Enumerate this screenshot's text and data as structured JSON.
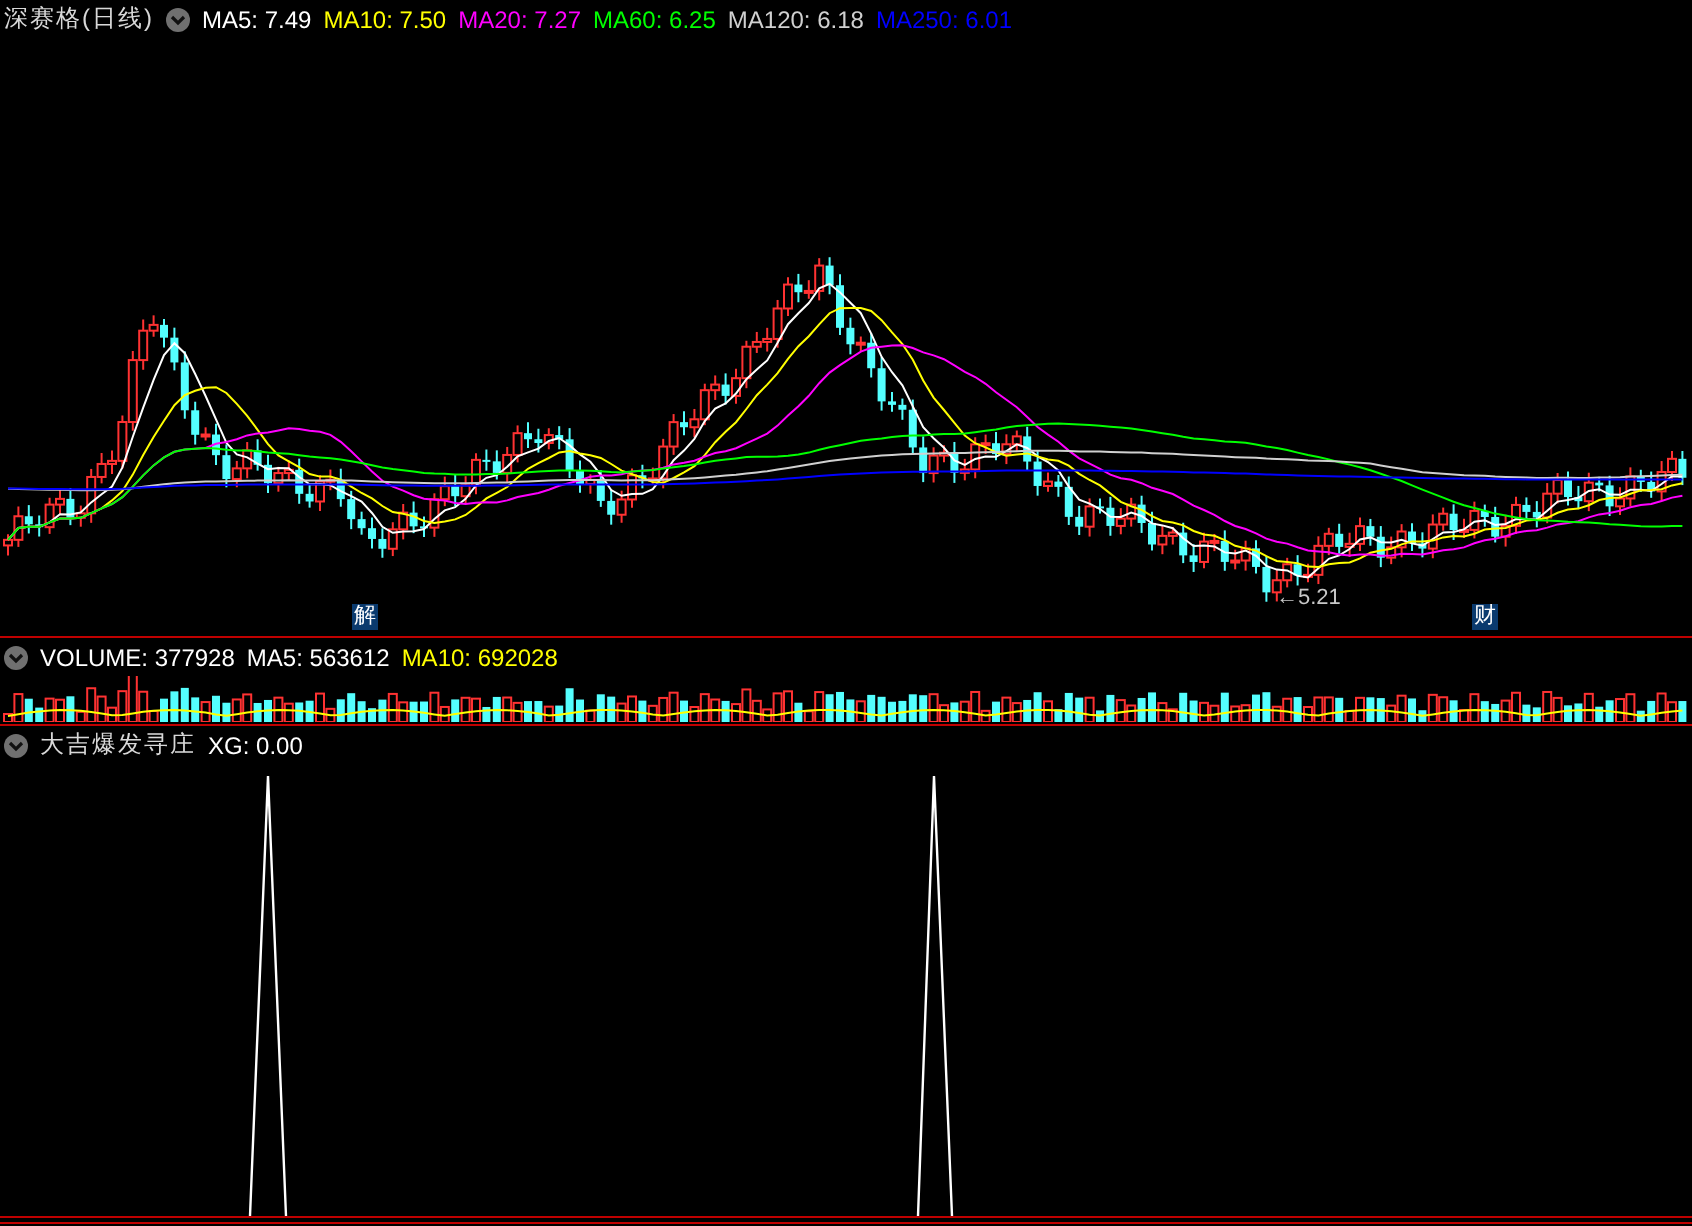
{
  "header": {
    "title": "深赛格(日线)",
    "ma_legend": [
      {
        "label": "MA5:",
        "value": "7.49",
        "color": "#ffffff"
      },
      {
        "label": "MA10:",
        "value": "7.50",
        "color": "#ffff00"
      },
      {
        "label": "MA20:",
        "value": "7.27",
        "color": "#ff00ff"
      },
      {
        "label": "MA60:",
        "value": "6.25",
        "color": "#00ff00"
      },
      {
        "label": "MA120:",
        "value": "6.18",
        "color": "#d0d0d0"
      },
      {
        "label": "MA250:",
        "value": "6.01",
        "color": "#0000ff"
      }
    ]
  },
  "price_chart": {
    "markers": [
      "解",
      "财"
    ],
    "low_label": "←5.21"
  },
  "volume_panel": {
    "legend": [
      {
        "label": "VOLUME:",
        "value": "377928",
        "color": "#ffffff"
      },
      {
        "label": "MA5:",
        "value": "563612",
        "color": "#ffffff"
      },
      {
        "label": "MA10:",
        "value": "692028",
        "color": "#ffff00"
      }
    ]
  },
  "indicator_panel": {
    "title": "大吉爆发寻庄",
    "legend": [
      {
        "label": "XG:",
        "value": "0.00",
        "color": "#ffffff"
      }
    ]
  }
}
